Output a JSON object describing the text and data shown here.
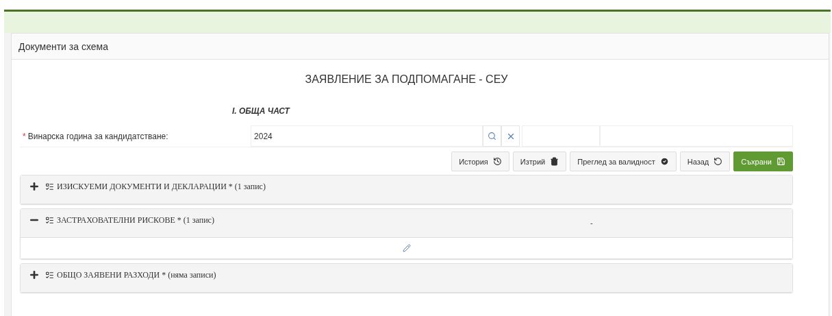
{
  "panel_title": "Документи за схема",
  "form_title": "ЗАЯВЛЕНИЕ ЗА ПОДПОМАГАНЕ - СЕУ",
  "section_title": "I. ОБЩА ЧАСТ",
  "field": {
    "required_mark": "*",
    "label": "Винарска година за кандидатстване:",
    "value": "2024"
  },
  "buttons": [
    {
      "label": "История",
      "kind": "history"
    },
    {
      "label": "Изтрий",
      "kind": "delete"
    },
    {
      "label": "Преглед за валидност",
      "kind": "validate"
    },
    {
      "label": "Назад",
      "kind": "back"
    },
    {
      "label": "Съхрани",
      "kind": "save"
    }
  ],
  "sections": [
    {
      "title": "ИЗИСКУЕМИ ДОКУМЕНТИ И ДЕКЛАРАЦИИ * (1 запис)",
      "expanded": false
    },
    {
      "title": "ЗАСТРАХОВАТЕЛНИ РИСКОВЕ * (1 запис)",
      "expanded": true,
      "header_note": "-"
    },
    {
      "title": "ОБЩО ЗАЯВЕНИ РАЗХОДИ * (няма записи)",
      "expanded": false
    }
  ]
}
